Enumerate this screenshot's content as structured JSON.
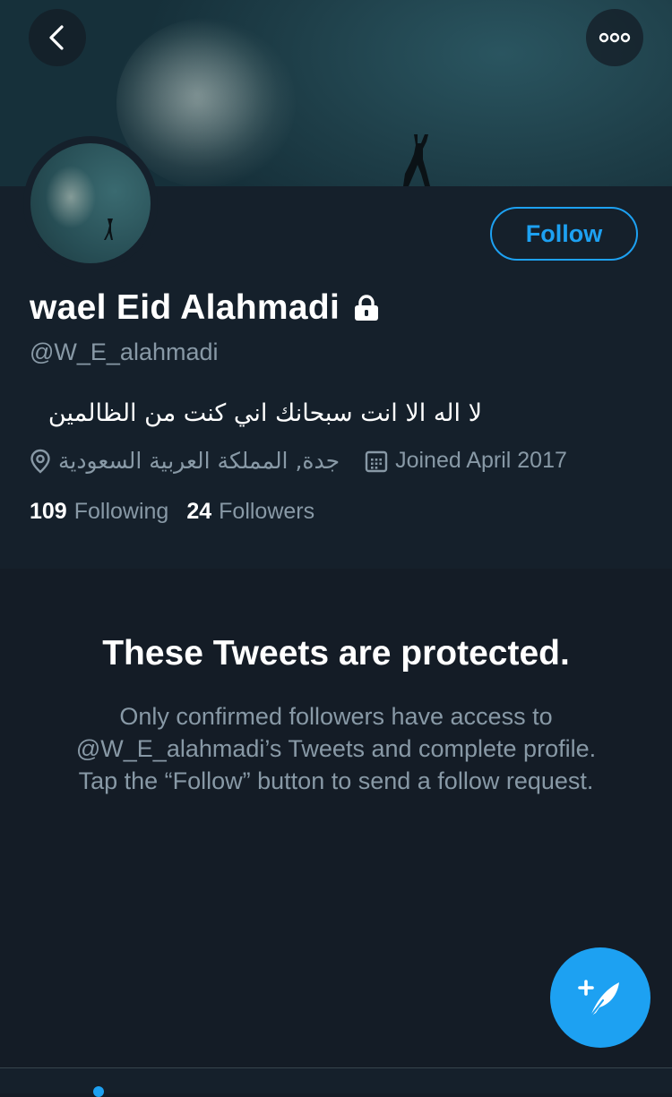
{
  "profile": {
    "display_name": "wael Eid Alahmadi",
    "handle": "@W_E_alahmadi",
    "bio": "لا اله الا انت سبحانك اني كنت من الظالمين",
    "location": "جدة, المملكة العربية السعودية",
    "joined": "Joined April 2017",
    "following_count": "109",
    "following_label": "Following",
    "followers_count": "24",
    "followers_label": "Followers",
    "follow_button_label": "Follow",
    "locked": true
  },
  "protected": {
    "title": "These Tweets are protected.",
    "message": "Only confirmed followers have access to @W_E_alahmadi’s Tweets and complete profile. Tap the “Follow” button to send a follow request."
  },
  "icons": {
    "back": "chevron-left-icon",
    "more": "more-dots-icon",
    "lock": "lock-icon",
    "location": "location-pin-icon",
    "calendar": "calendar-icon",
    "compose": "compose-tweet-icon"
  },
  "colors": {
    "background": "#15202b",
    "accent": "#1da1f2",
    "secondary_text": "#8899a6"
  }
}
